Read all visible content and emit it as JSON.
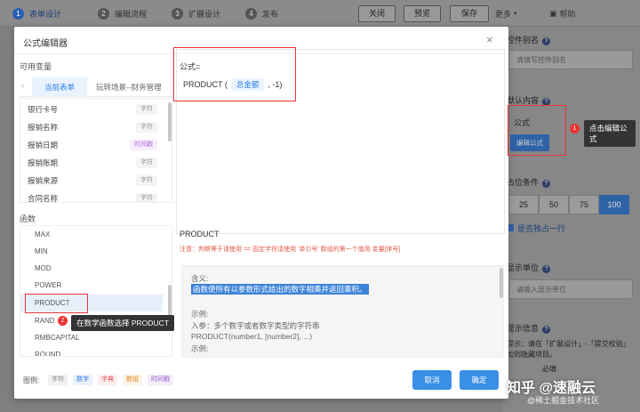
{
  "steps": [
    {
      "num": "1",
      "label": "表单设计"
    },
    {
      "num": "2",
      "label": "编辑流程"
    },
    {
      "num": "3",
      "label": "扩展设计"
    },
    {
      "num": "4",
      "label": "发布"
    }
  ],
  "toolbar": {
    "close": "关闭",
    "preview": "预览",
    "save": "保存",
    "more": "更多",
    "help": "帮助"
  },
  "right_panel": {
    "alias_label": "控件别名",
    "alias_placeholder": "请填写控件别名",
    "default_label": "默认内容",
    "formula_text": "公式",
    "edit_formula_btn": "编辑公式",
    "width_label": "占位条件",
    "widths": [
      "25",
      "50",
      "75",
      "100"
    ],
    "exclusive_label": "是否独占一行",
    "unit_label": "显示单位",
    "unit_placeholder": "请输入显示单位",
    "tip_label": "提示信息",
    "tip_text": "提示：请在「扩展设计」-「提交校验」",
    "tip_text2": "加到隐藏项目。",
    "required": "必填"
  },
  "dialog": {
    "title": "公式编辑器",
    "vars_label": "可用变量",
    "tabs": [
      "当前表单",
      "玩转场景--财务管理"
    ],
    "variables": [
      {
        "name": "银行卡号",
        "type": "字符"
      },
      {
        "name": "报销名称",
        "type": "字符"
      },
      {
        "name": "报销日期",
        "type": "时间戳"
      },
      {
        "name": "报销账期",
        "type": "字符"
      },
      {
        "name": "报销来源",
        "type": "字符"
      },
      {
        "name": "合同名称",
        "type": "字符"
      }
    ],
    "functions_label": "函数",
    "functions": [
      "MAX",
      "MIN",
      "MOD",
      "POWER",
      "PRODUCT",
      "RAND",
      "RMBCAPITAL",
      "ROUND"
    ],
    "formula_label": "公式=",
    "formula_fn": "PRODUCT (",
    "formula_chip": "总金额",
    "formula_rest": ", -1)",
    "fn_title": "PRODUCT",
    "fn_note": "注意：判断等于请使用 == 固定字符请使用 '单引号' 数组的第一个值用 变量[序号]",
    "help_lines": [
      {
        "text": "含义:",
        "sel": false
      },
      {
        "text": "函数使所有以参数形式给出的数字相乘并返回乘积。",
        "sel": true
      },
      {
        "text": "",
        "sel": false
      },
      {
        "text": "示例:",
        "sel": false
      },
      {
        "text": "入参：多个数字或者数字类型的字符串",
        "sel": false
      },
      {
        "text": "PRODUCT(number1, [number2], ...)",
        "sel": false
      },
      {
        "text": "示例:",
        "sel": false
      }
    ],
    "legend_label": "图例:",
    "legend": [
      {
        "text": "字符",
        "color": "#f1f1f1",
        "fg": "#888"
      },
      {
        "text": "数字",
        "color": "#e8f1fd",
        "fg": "#3a7de0"
      },
      {
        "text": "字典",
        "color": "#fdeeee",
        "fg": "#e05555"
      },
      {
        "text": "数组",
        "color": "#fdf3e6",
        "fg": "#e08a2a"
      },
      {
        "text": "时间戳",
        "color": "#f4eefb",
        "fg": "#9a5bd0"
      }
    ],
    "cancel": "取消",
    "confirm": "确定"
  },
  "annotations": {
    "badge1": "1",
    "tip1_line1": "点击编辑公",
    "tip1_line2": "式",
    "badge2": "2",
    "tip2": "在数学函数选择 PRODUCT"
  },
  "watermark": "知乎 @速融云",
  "watermark2": "@稀土掘金技术社区"
}
